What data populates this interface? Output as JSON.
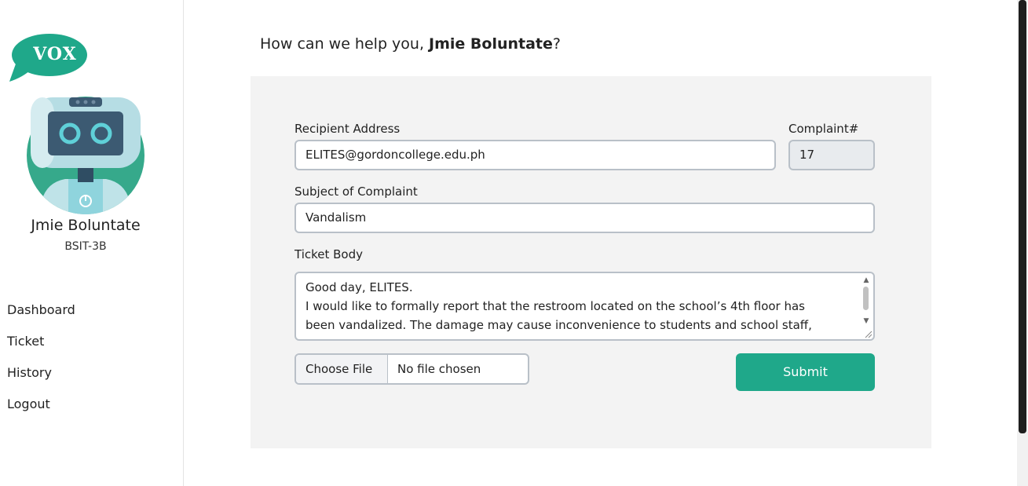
{
  "logo": {
    "text": "VOX",
    "brand_color": "#1fa88a",
    "icon": "speech-bubble-logo"
  },
  "user": {
    "name": "Jmie Boluntate",
    "section": "BSIT-3B",
    "avatar": "robot-avatar"
  },
  "nav": {
    "items": [
      {
        "label": "Dashboard"
      },
      {
        "label": "Ticket"
      },
      {
        "label": "History"
      },
      {
        "label": "Logout"
      }
    ]
  },
  "greeting": {
    "prefix": "How can we help you, ",
    "name": "Jmie Boluntate",
    "suffix": "?"
  },
  "form": {
    "recipient": {
      "label": "Recipient Address",
      "value": "ELITES@gordoncollege.edu.ph"
    },
    "complaint_no": {
      "label": "Complaint#",
      "value": "17"
    },
    "subject": {
      "label": "Subject of Complaint",
      "value": "Vandalism"
    },
    "body": {
      "label": "Ticket Body",
      "lines": [
        "Good day, ELITES.",
        "I would like to formally report that the restroom located on the school’s 4th floor has",
        "been vandalized. The damage may cause inconvenience to students and school staff,"
      ]
    },
    "file": {
      "button_label": "Choose File",
      "status": "No file chosen"
    },
    "submit_label": "Submit"
  },
  "colors": {
    "accent": "#1fa88a",
    "card_background": "#f3f3f3",
    "input_border": "#b9c0c8"
  }
}
